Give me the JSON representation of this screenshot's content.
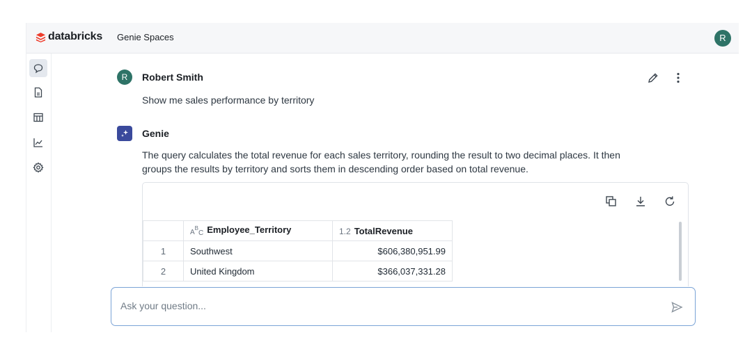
{
  "header": {
    "brand": "databricks",
    "space_name": "Genie Spaces",
    "user_initial": "R"
  },
  "sidebar": {
    "items": [
      {
        "icon": "chat-icon",
        "active": true
      },
      {
        "icon": "document-icon",
        "active": false
      },
      {
        "icon": "table-icon",
        "active": false
      },
      {
        "icon": "chart-icon",
        "active": false
      },
      {
        "icon": "gear-icon",
        "active": false
      }
    ]
  },
  "conversation": {
    "user_message": {
      "avatar_initial": "R",
      "author": "Robert Smith",
      "text": "Show me sales performance by territory"
    },
    "genie_message": {
      "author": "Genie",
      "text_line1": "The query calculates the total revenue for each sales territory, rounding the result to two decimal places. It then",
      "text_line2": "groups the results by territory and sorts them in descending order based on total revenue."
    }
  },
  "result_table": {
    "columns": [
      {
        "type_tag": "",
        "label": ""
      },
      {
        "type_tag": "ABC",
        "label": "Employee_Territory"
      },
      {
        "type_tag": "1.2",
        "label": "TotalRevenue"
      }
    ],
    "rows": [
      {
        "index": "1",
        "territory": "Southwest",
        "revenue": "$606,380,951.99"
      },
      {
        "index": "2",
        "territory": "United Kingdom",
        "revenue": "$366,037,331.28"
      }
    ]
  },
  "question_input": {
    "placeholder": "Ask your question...",
    "value": ""
  },
  "colors": {
    "brand": "#ee3d2c",
    "avatar": "#2e7367",
    "genie": "#3a4a9c",
    "input_border": "#7aa3d6"
  }
}
